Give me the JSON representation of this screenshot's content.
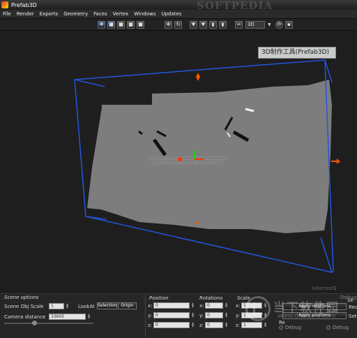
{
  "window": {
    "title": "Prefab3D",
    "watermark_top": "SOFTPEDIA"
  },
  "menu": [
    "File",
    "Render",
    "Exports",
    "Geometry",
    "Faces",
    "Vertex",
    "Windows",
    "Updates"
  ],
  "toolbar": {
    "view_mode": "3D"
  },
  "viewport": {
    "tooltip": "3D制作工具(Prefab3D)",
    "selected_label": "Selected:",
    "selected_value": "1",
    "accent_blue": "#2255dd",
    "accent_orange": "#ff5500"
  },
  "scene_options": {
    "title": "Scene options",
    "obj_scale_label": "Scene Obj Scale",
    "obj_scale_value": "1",
    "lookat_label": "LookAt",
    "selection_btn": "Selection",
    "origin_btn": "Origin",
    "camera_distance_label": "Camera distance",
    "camera_distance_value": "33605"
  },
  "position": {
    "title": "Position",
    "x": "0",
    "y": "0",
    "z": "0"
  },
  "rotations": {
    "title": "Rotations",
    "x": "0",
    "y": "0",
    "z": "0"
  },
  "scale": {
    "title": "Scale",
    "x": "1",
    "y": "1",
    "z": "1"
  },
  "axis_labels": {
    "x": "x:",
    "y": "y:",
    "z": "z:"
  },
  "right_panel": {
    "apply_rotations": "Apply rotations",
    "apply_positions": "Apply positions",
    "debug_left": "Debug",
    "debug_right": "Debug",
    "debug_top": "Debug",
    "cut_rec": "Rec",
    "cut_se": "Se",
    "cut_re": "Re",
    "cut_set": "Set"
  },
  "watermark_bottom": {
    "text": "当下软件园",
    "url": "www.downxia.com"
  }
}
